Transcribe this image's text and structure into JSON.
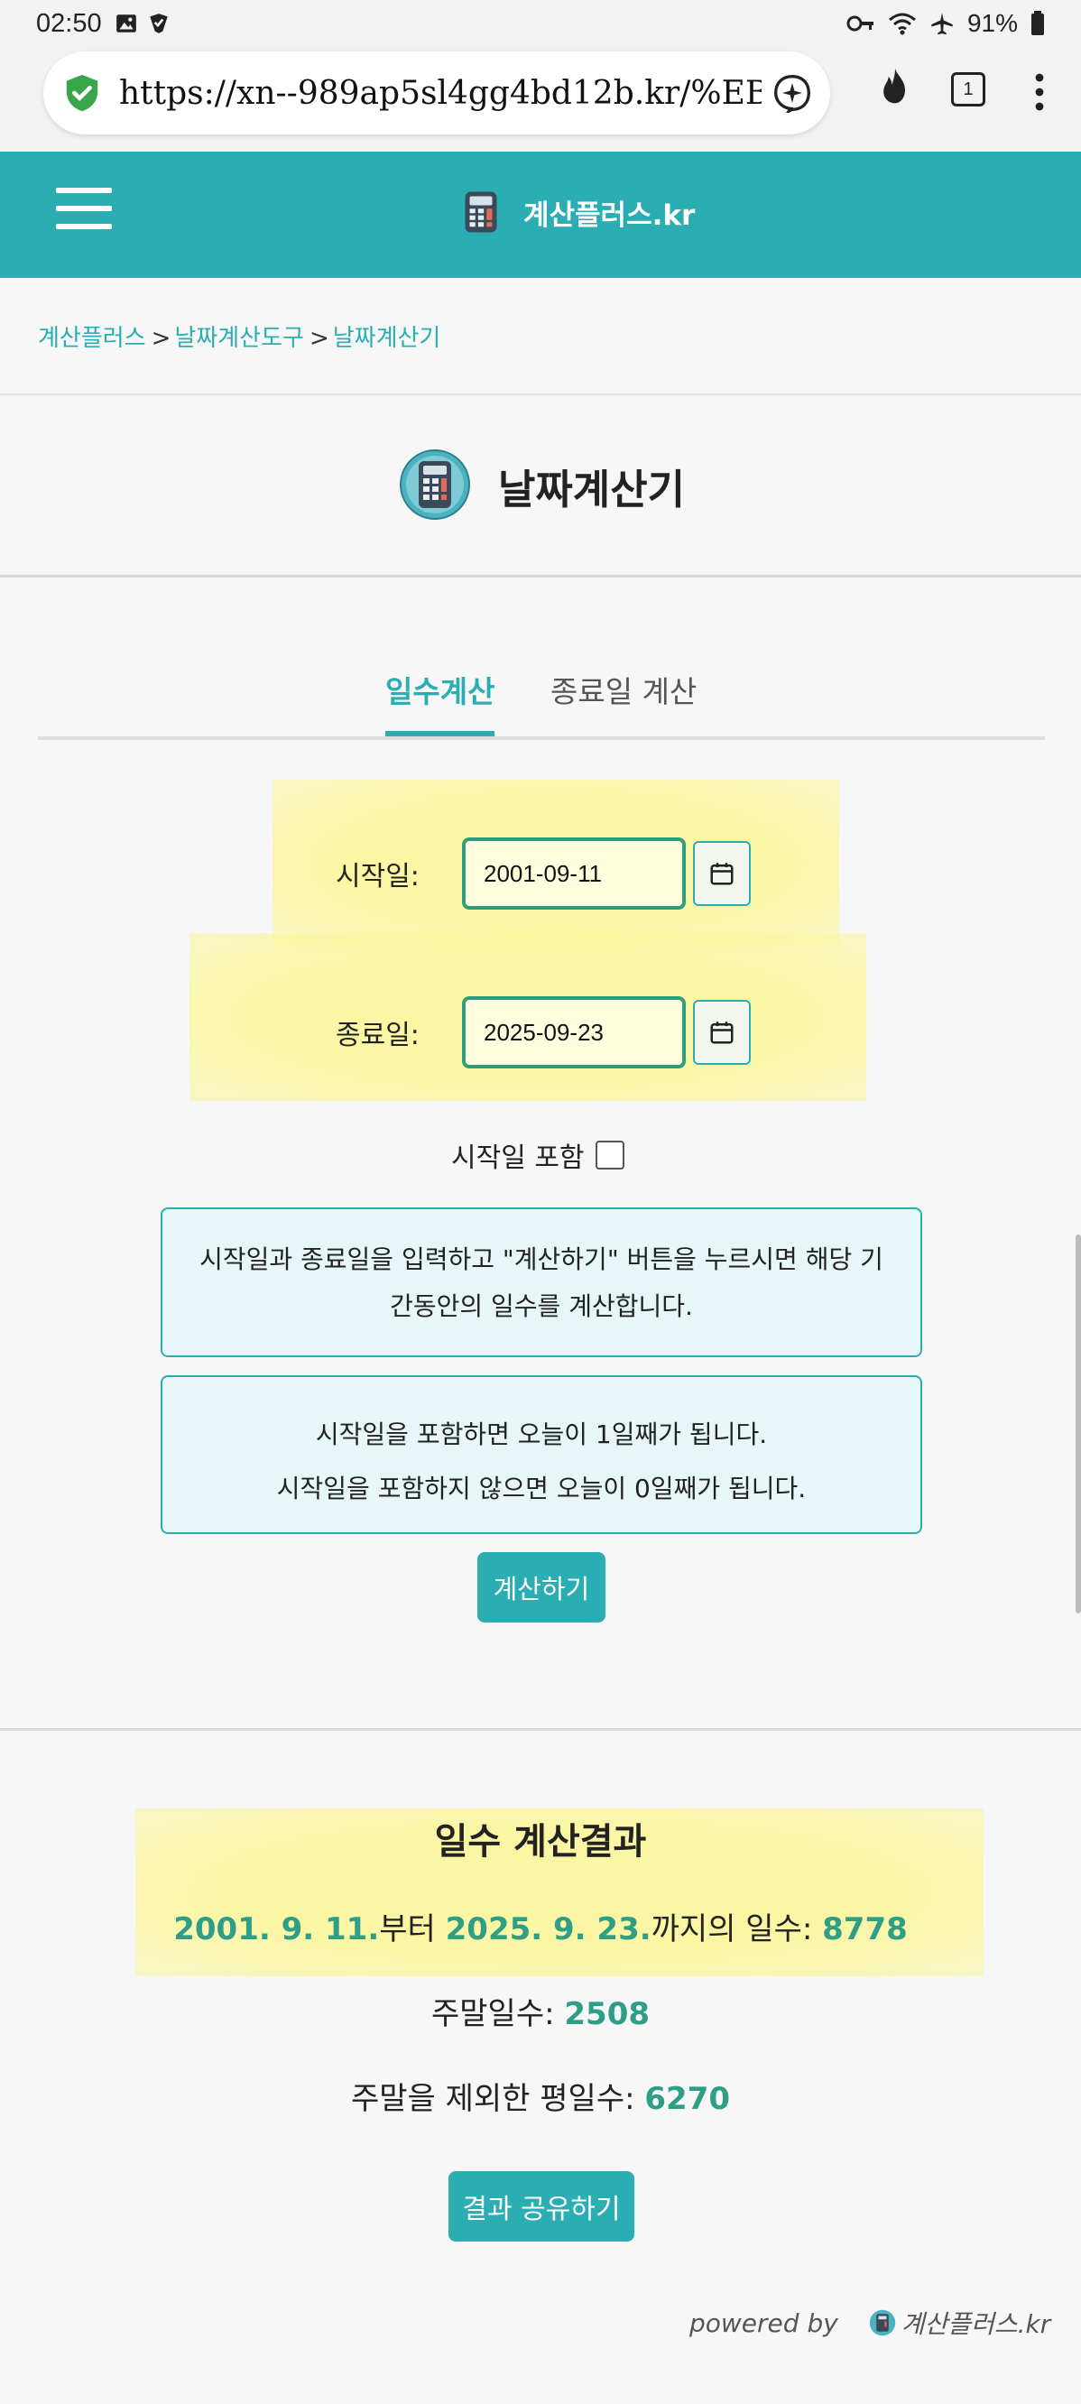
{
  "status_bar": {
    "time": "02:50",
    "battery": "91%"
  },
  "browser": {
    "url": "https://xn--989ap5sl4gg4bd12b.kr/%EB%8",
    "tab_count": "1"
  },
  "header": {
    "site_name": "계산플러스.kr"
  },
  "breadcrumb": {
    "items": [
      "계산플러스",
      "날짜계산도구",
      "날짜계산기"
    ],
    "separator": ">"
  },
  "page_title": "날짜계산기",
  "tabs": [
    "일수계산",
    "종료일 계산"
  ],
  "form": {
    "start_label": "시작일:",
    "start_value": "2001-09-11",
    "end_label": "종료일:",
    "end_value": "2025-09-23",
    "include_label": "시작일 포함",
    "include_checked": false
  },
  "info": {
    "box1_line1": "시작일과 종료일을 입력하고 \"계산하기\" 버튼을 누르시면 해당 기",
    "box1_line2": "간동안의 일수를 계산합니다.",
    "box2_line1": "시작일을 포함하면 오늘이 1일째가 됩니다.",
    "box2_line2": "시작일을 포함하지 않으면 오늘이 0일째가 됩니다."
  },
  "calculate_button": "계산하기",
  "result": {
    "title": "일수 계산결과",
    "start_date": "2001. 9. 11.",
    "from_text": "부터 ",
    "end_date": "2025. 9. 23.",
    "until_text": "까지의 일수: ",
    "total_days": "8778",
    "weekend_label": "주말일수: ",
    "weekend_days": "2508",
    "weekday_label": "주말을 제외한 평일수: ",
    "weekday_days": "6270",
    "share_button": "결과 공유하기"
  },
  "footer": {
    "powered_by": "powered by",
    "brand": "계산플러스.kr"
  },
  "colors": {
    "teal": "#2aaeb3",
    "highlight": "#f9f5a6",
    "result_teal": "#2e9e86"
  }
}
